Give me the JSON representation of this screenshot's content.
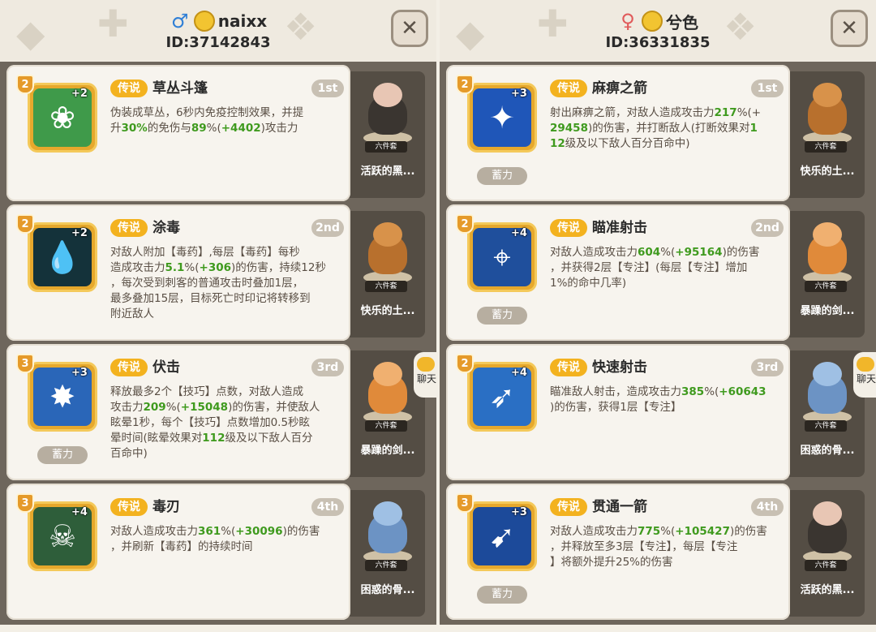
{
  "colors": {
    "legend_badge": "#f3b21f",
    "bonus_text": "#3f9a1e",
    "frame_gold": "#e6a82c",
    "panel_bg": "#6e665c"
  },
  "players": [
    {
      "gender_icon": "male-symbol",
      "gender_glyph": "♂",
      "name": "naixx",
      "id_text": "ID:37142843",
      "skills": [
        {
          "level": "2",
          "plus": "+2",
          "rarity": "传说",
          "name": "草丛斗篷",
          "rank": "1st",
          "icon": "leafy-bush-icon",
          "icon_glyph": "❀",
          "icon_bg": "#3f9a4a",
          "desc_parts": [
            [
              "伪装成草丛，6秒内免疫控制效果，并提\n升",
              false
            ],
            [
              "30%",
              true
            ],
            [
              "的免伤与",
              false
            ],
            [
              "89",
              true
            ],
            [
              "%(",
              false
            ],
            [
              "+4402",
              true
            ],
            [
              ")攻击力",
              false
            ]
          ],
          "charge": null,
          "pet": {
            "name": "活跃的黑...",
            "set": "六件套",
            "color": "#3a3530",
            "head": "#e8c6b4"
          }
        },
        {
          "level": "2",
          "plus": "+2",
          "rarity": "传说",
          "name": "涂毒",
          "rank": "2nd",
          "icon": "poison-drop-icon",
          "icon_glyph": "💧",
          "icon_bg": "#14323a",
          "desc_parts": [
            [
              "对敌人附加【毒药】,每层【毒药】每秒\n造成攻击力",
              false
            ],
            [
              "5.1",
              true
            ],
            [
              "%(",
              false
            ],
            [
              "+306",
              true
            ],
            [
              ")的伤害，持续12秒\n，每次受到刺客的普通攻击时叠加1层，\n最多叠加15层，目标死亡时印记将转移到\n附近敌人",
              false
            ]
          ],
          "charge": null,
          "pet": {
            "name": "快乐的土...",
            "set": "六件套",
            "color": "#b8702d",
            "head": "#d8924a"
          }
        },
        {
          "level": "3",
          "plus": "+3",
          "rarity": "传说",
          "name": "伏击",
          "rank": "3rd",
          "icon": "ambush-burst-icon",
          "icon_glyph": "✸",
          "icon_bg": "#2a66b8",
          "desc_parts": [
            [
              "释放最多2个【技巧】点数，对敌人造成\n攻击力",
              false
            ],
            [
              "209",
              true
            ],
            [
              "%(",
              false
            ],
            [
              "+15048",
              true
            ],
            [
              ")的伤害，并使敌人\n眩晕1秒，每个【技巧】点数增加0.5秒眩\n晕时间(眩晕效果对",
              false
            ],
            [
              "112",
              true
            ],
            [
              "级及以下敌人百分\n百命中)",
              false
            ]
          ],
          "charge": "蓄力",
          "pet": {
            "name": "暴躁的剑...",
            "set": "六件套",
            "color": "#e08a3a",
            "head": "#f0b070"
          }
        },
        {
          "level": "3",
          "plus": "+4",
          "rarity": "传说",
          "name": "毒刃",
          "rank": "4th",
          "icon": "toxic-skull-icon",
          "icon_glyph": "☠",
          "icon_bg": "#2e5e3a",
          "desc_parts": [
            [
              "对敌人造成攻击力",
              false
            ],
            [
              "361",
              true
            ],
            [
              "%(",
              false
            ],
            [
              "+30096",
              true
            ],
            [
              ")的伤害\n，并刷新【毒药】的持续时间",
              false
            ]
          ],
          "charge": null,
          "pet": {
            "name": "困惑的骨...",
            "set": "六件套",
            "color": "#6c93c4",
            "head": "#9fc0e4"
          }
        }
      ]
    },
    {
      "gender_icon": "female-symbol",
      "gender_glyph": "♀",
      "name": "兮色",
      "id_text": "ID:36331835",
      "skills": [
        {
          "level": "2",
          "plus": "+3",
          "rarity": "传说",
          "name": "麻痹之箭",
          "rank": "1st",
          "icon": "paralyze-arrow-icon",
          "icon_glyph": "✦",
          "icon_bg": "#1f56b8",
          "desc_parts": [
            [
              "射出麻痹之箭，对敌人造成攻击力",
              false
            ],
            [
              "217",
              true
            ],
            [
              "%(+\n",
              false
            ],
            [
              "29458",
              true
            ],
            [
              ")的伤害，并打断敌人(打断效果对",
              false
            ],
            [
              "1\n12",
              true
            ],
            [
              "级及以下敌人百分百命中)",
              false
            ]
          ],
          "charge": "蓄力",
          "pet": {
            "name": "快乐的土...",
            "set": "六件套",
            "color": "#b8702d",
            "head": "#d8924a"
          }
        },
        {
          "level": "2",
          "plus": "+4",
          "rarity": "传说",
          "name": "瞄准射击",
          "rank": "2nd",
          "icon": "crosshair-icon",
          "icon_glyph": "⌖",
          "icon_bg": "#1f4f9c",
          "desc_parts": [
            [
              "对敌人造成攻击力",
              false
            ],
            [
              "604",
              true
            ],
            [
              "%(",
              false
            ],
            [
              "+95164",
              true
            ],
            [
              ")的伤害\n，并获得2层【专注】(每层【专注】增加\n1%的命中几率)",
              false
            ]
          ],
          "charge": "蓄力",
          "pet": {
            "name": "暴躁的剑...",
            "set": "六件套",
            "color": "#e08a3a",
            "head": "#f0b070"
          }
        },
        {
          "level": "2",
          "plus": "+4",
          "rarity": "传说",
          "name": "快速射击",
          "rank": "3rd",
          "icon": "bow-arrow-icon",
          "icon_glyph": "➶",
          "icon_bg": "#2a6fc4",
          "desc_parts": [
            [
              "瞄准敌人射击，造成攻击力",
              false
            ],
            [
              "385",
              true
            ],
            [
              "%(",
              false
            ],
            [
              "+60643",
              true
            ],
            [
              "\n)的伤害，获得1层【专注】",
              false
            ]
          ],
          "charge": null,
          "pet": {
            "name": "困惑的骨...",
            "set": "六件套",
            "color": "#6c93c4",
            "head": "#9fc0e4"
          }
        },
        {
          "level": "3",
          "plus": "+3",
          "rarity": "传说",
          "name": "贯通一箭",
          "rank": "4th",
          "icon": "piercing-arrow-icon",
          "icon_glyph": "➹",
          "icon_bg": "#1c4a9a",
          "desc_parts": [
            [
              "对敌人造成攻击力",
              false
            ],
            [
              "775",
              true
            ],
            [
              "%(",
              false
            ],
            [
              "+105427",
              true
            ],
            [
              ")的伤害\n，并释放至多3层【专注】，每层【专注\n】将额外提升25%的伤害",
              false
            ]
          ],
          "charge": "蓄力",
          "pet": {
            "name": "活跃的黑...",
            "set": "六件套",
            "color": "#3a3530",
            "head": "#e8c6b4"
          }
        }
      ]
    }
  ],
  "chat_tab_label": "聊天"
}
